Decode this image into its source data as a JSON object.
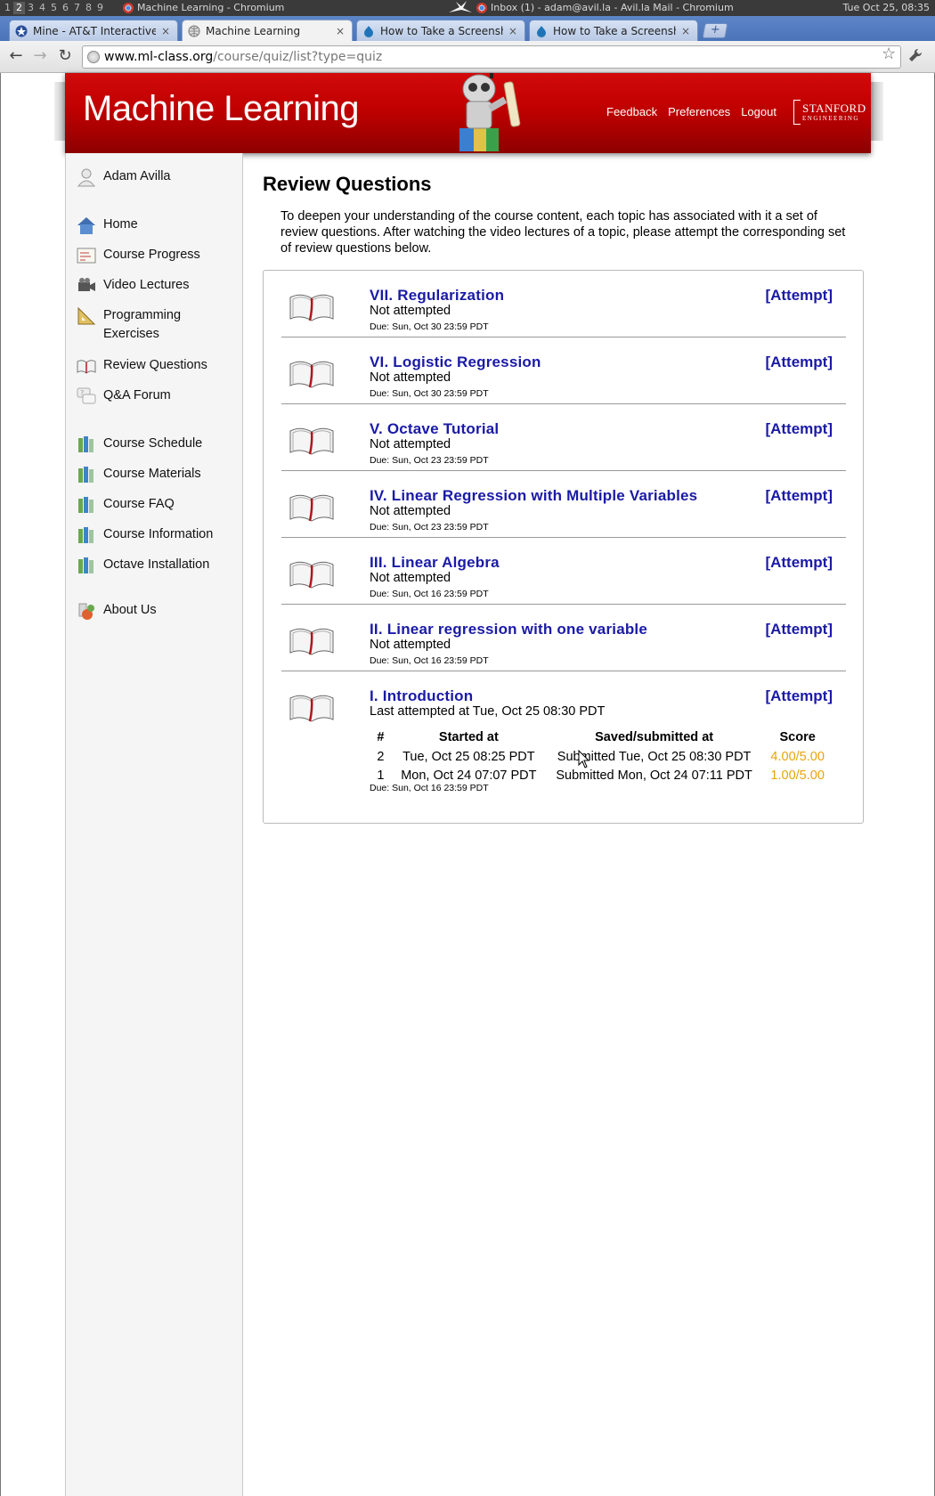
{
  "os_panel": {
    "workspaces": [
      "1",
      "2",
      "3",
      "4",
      "5",
      "6",
      "7",
      "8",
      "9"
    ],
    "active_workspace": "2",
    "window_left": "Machine Learning - Chromium",
    "window_right": "Inbox (1) - adam@avil.la - Avil.la Mail - Chromium",
    "clock": "Tue Oct 25, 08:35"
  },
  "tabs": [
    {
      "title": "Mine - AT&T Interactive",
      "close": "×"
    },
    {
      "title": "Machine Learning",
      "close": "×"
    },
    {
      "title": "How to Take a Screenshot",
      "close": "×"
    },
    {
      "title": "How to Take a Screenshot",
      "close": "×"
    }
  ],
  "new_tab": "+",
  "toolbar": {
    "back": "←",
    "forward": "→",
    "reload": "↻",
    "url_host": "www.ml-class.org",
    "url_path": "/course/quiz/list?type=quiz",
    "star": "☆",
    "wrench": "🔧"
  },
  "header": {
    "site_title": "Machine Learning",
    "links": [
      "Feedback",
      "Preferences",
      "Logout"
    ],
    "logo_line1": "STANFORD",
    "logo_line2": "ENGINEERING"
  },
  "sidebar": {
    "user": "Adam Avilla",
    "items": [
      {
        "label": "Home",
        "icon": "home-icon"
      },
      {
        "label": "Course Progress",
        "icon": "progress-icon"
      },
      {
        "label": "Video Lectures",
        "icon": "video-camera-icon"
      },
      {
        "label": "Programming Exercises",
        "icon": "ruler-triangle-icon"
      },
      {
        "label": "Review Questions",
        "icon": "book-icon"
      },
      {
        "label": "Q&A Forum",
        "icon": "forum-icon"
      },
      {
        "label": "Course Schedule",
        "icon": "schedule-icon"
      },
      {
        "label": "Course Materials",
        "icon": "materials-icon"
      },
      {
        "label": "Course FAQ",
        "icon": "faq-icon"
      },
      {
        "label": "Course Information",
        "icon": "info-icon"
      },
      {
        "label": "Octave Installation",
        "icon": "installation-icon"
      },
      {
        "label": "About Us",
        "icon": "about-icon"
      }
    ]
  },
  "main": {
    "title": "Review Questions",
    "intro": "To deepen your understanding of the course content, each topic has associated with it a set of review questions. After watching the video lectures of a topic, please attempt the corresponding set of review questions below.",
    "attempt_label": "[Attempt]",
    "quizzes": [
      {
        "title": "VII. Regularization",
        "status": "Not attempted",
        "due": "Due: Sun, Oct 30 23:59 PDT"
      },
      {
        "title": "VI. Logistic Regression",
        "status": "Not attempted",
        "due": "Due: Sun, Oct 30 23:59 PDT"
      },
      {
        "title": "V. Octave Tutorial",
        "status": "Not attempted",
        "due": "Due: Sun, Oct 23 23:59 PDT"
      },
      {
        "title": "IV. Linear Regression with Multiple Variables",
        "status": "Not attempted",
        "due": "Due: Sun, Oct 23 23:59 PDT"
      },
      {
        "title": "III. Linear Algebra",
        "status": "Not attempted",
        "due": "Due: Sun, Oct 16 23:59 PDT"
      },
      {
        "title": "II. Linear regression with one variable",
        "status": "Not attempted",
        "due": "Due: Sun, Oct 16 23:59 PDT"
      },
      {
        "title": "I. Introduction",
        "status": "Last attempted at Tue, Oct 25 08:30 PDT",
        "due": "Due: Sun, Oct 16 23:59 PDT",
        "attempts_header": [
          "#",
          "Started at",
          "Saved/submitted at",
          "Score"
        ],
        "attempts": [
          {
            "n": "2",
            "started": "Tue, Oct 25 08:25 PDT",
            "submitted": "Submitted Tue, Oct 25 08:30 PDT",
            "score": "4.00/5.00"
          },
          {
            "n": "1",
            "started": "Mon, Oct 24 07:07 PDT",
            "submitted": "Submitted Mon, Oct 24 07:11 PDT",
            "score": "1.00/5.00"
          }
        ]
      }
    ]
  },
  "colors": {
    "banner_red": "#c00000",
    "link_blue": "#1a1aa6",
    "score_orange": "#e8a30c",
    "sidebar_bg": "#f5f5f5"
  }
}
